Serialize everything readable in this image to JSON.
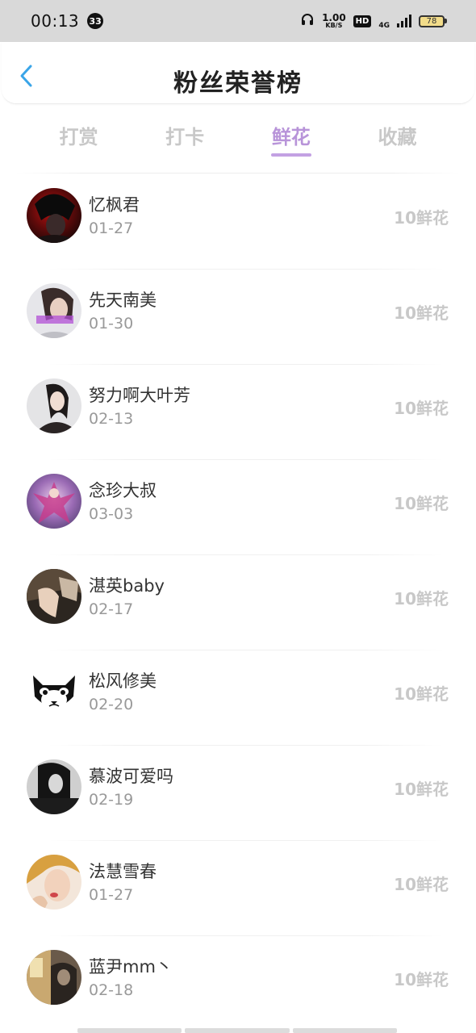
{
  "status_bar": {
    "time": "00:13",
    "notification_count": "33",
    "speed_value": "1.00",
    "speed_unit": "KB/S",
    "hd": "HD",
    "network": "4G",
    "battery": "78"
  },
  "header": {
    "title": "粉丝荣誉榜"
  },
  "tabs": [
    {
      "label": "打赏"
    },
    {
      "label": "打卡"
    },
    {
      "label": "鲜花"
    },
    {
      "label": "收藏"
    }
  ],
  "active_tab": "鲜花",
  "colors": {
    "accent": "#b894d9",
    "inactive": "#c8c8c8"
  },
  "fans": [
    {
      "name": "忆枫君",
      "date": "01-27",
      "amount": "10鲜花"
    },
    {
      "name": "先天南美",
      "date": "01-30",
      "amount": "10鲜花"
    },
    {
      "name": "努力啊大叶芳",
      "date": "02-13",
      "amount": "10鲜花"
    },
    {
      "name": "念珍大叔",
      "date": "03-03",
      "amount": "10鲜花"
    },
    {
      "name": "湛英baby",
      "date": "02-17",
      "amount": "10鲜花"
    },
    {
      "name": "松风修美",
      "date": "02-20",
      "amount": "10鲜花"
    },
    {
      "name": "慕波可爱吗",
      "date": "02-19",
      "amount": "10鲜花"
    },
    {
      "name": "法慧雪春",
      "date": "01-27",
      "amount": "10鲜花"
    },
    {
      "name": "蓝尹mm丶",
      "date": "02-18",
      "amount": "10鲜花"
    }
  ]
}
